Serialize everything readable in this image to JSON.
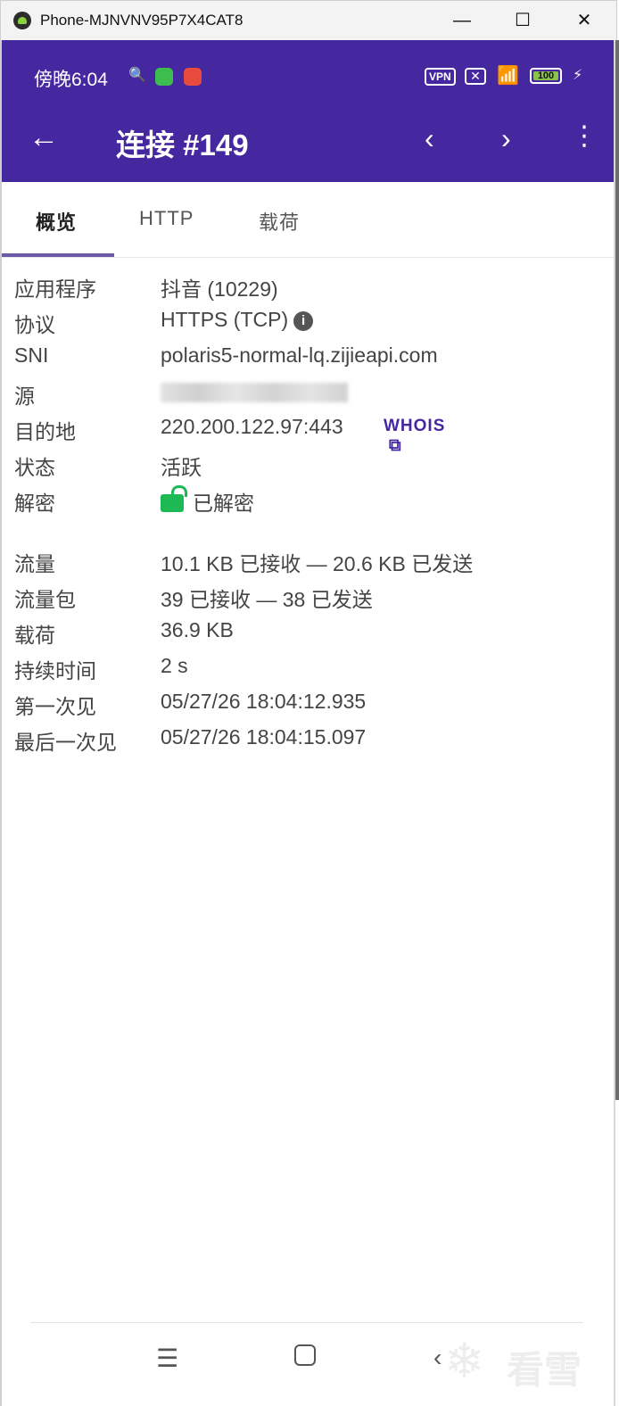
{
  "window": {
    "title": "Phone-MJNVNV95P7X4CAT8",
    "minimize": "—",
    "maximize": "☐",
    "close": "✕"
  },
  "status_bar": {
    "time": "傍晚6:04",
    "vpn": "VPN",
    "battery": "100"
  },
  "toolbar": {
    "title": "连接 #149"
  },
  "tabs": [
    {
      "label": "概览"
    },
    {
      "label": "HTTP"
    },
    {
      "label": "载荷"
    }
  ],
  "details": {
    "app_label": "应用程序",
    "app_value": "抖音 (10229)",
    "protocol_label": "协议",
    "protocol_value": "HTTPS (TCP)",
    "sni_label": "SNI",
    "sni_value": "polaris5-normal-lq.zijieapi.com",
    "source_label": "源",
    "dest_label": "目的地",
    "dest_value": "220.200.122.97:443",
    "whois": "WHOIS",
    "state_label": "状态",
    "state_value": "活跃",
    "decrypt_label": "解密",
    "decrypt_value": "已解密"
  },
  "stats": {
    "traffic_label": "流量",
    "traffic_value": "10.1 KB 已接收 — 20.6 KB 已发送",
    "packets_label": "流量包",
    "packets_value": "39 已接收 — 38 已发送",
    "payload_label": "载荷",
    "payload_value": "36.9 KB",
    "duration_label": "持续时间",
    "duration_value": "2 s",
    "first_seen_label": "第一次见",
    "first_seen_value": "05/27/26 18:04:12.935",
    "last_seen_label": "最后一次见",
    "last_seen_value": "05/27/26 18:04:15.097"
  },
  "watermark": {
    "text": "看雪"
  },
  "colors": {
    "header": "#4527a0",
    "accent": "#4527a0",
    "lock": "#1db954"
  }
}
